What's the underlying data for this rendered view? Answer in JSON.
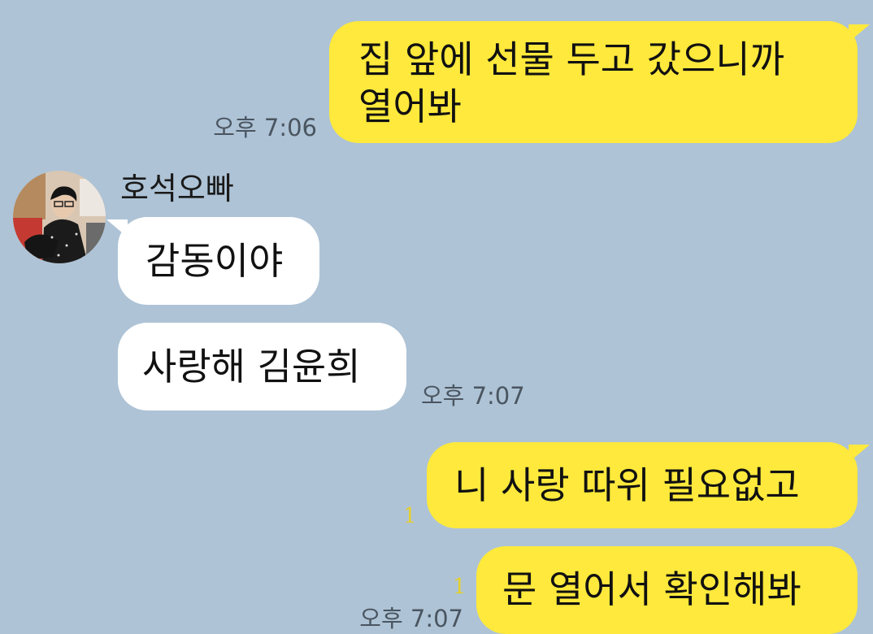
{
  "sender": {
    "name": "호석오빠"
  },
  "messages": [
    {
      "from": "me",
      "lines": [
        "집 앞에 선물 두고 갔으니까",
        "열어봐"
      ],
      "time": "오후 7:06"
    },
    {
      "from": "them",
      "text": "감동이야"
    },
    {
      "from": "them",
      "text": "사랑해 김윤희",
      "time": "오후 7:07"
    },
    {
      "from": "me",
      "text": "니 사랑 따위 필요없고",
      "unread": "1"
    },
    {
      "from": "me",
      "text": "문 열어서 확인해봐",
      "unread": "1",
      "time": "오후 7:07"
    }
  ],
  "colors": {
    "background": "#aec3d6",
    "my_bubble": "#fee93c",
    "their_bubble": "#ffffff",
    "unread_count": "#e6cf2e"
  }
}
